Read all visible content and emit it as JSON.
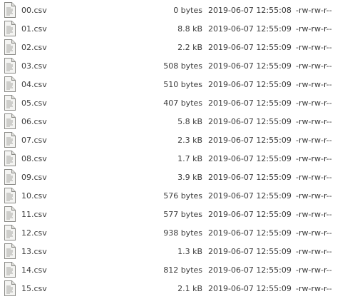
{
  "files": [
    {
      "name": "00.csv",
      "size": "0 bytes",
      "modified": "2019-06-07 12:55:08",
      "permissions": "-rw-rw-r--",
      "icon": "text-file-icon"
    },
    {
      "name": "01.csv",
      "size": "8.8 kB",
      "modified": "2019-06-07 12:55:09",
      "permissions": "-rw-rw-r--",
      "icon": "text-file-icon"
    },
    {
      "name": "02.csv",
      "size": "2.2 kB",
      "modified": "2019-06-07 12:55:09",
      "permissions": "-rw-rw-r--",
      "icon": "text-file-icon"
    },
    {
      "name": "03.csv",
      "size": "508 bytes",
      "modified": "2019-06-07 12:55:09",
      "permissions": "-rw-rw-r--",
      "icon": "text-file-icon"
    },
    {
      "name": "04.csv",
      "size": "510 bytes",
      "modified": "2019-06-07 12:55:09",
      "permissions": "-rw-rw-r--",
      "icon": "text-file-icon"
    },
    {
      "name": "05.csv",
      "size": "407 bytes",
      "modified": "2019-06-07 12:55:09",
      "permissions": "-rw-rw-r--",
      "icon": "text-file-icon"
    },
    {
      "name": "06.csv",
      "size": "5.8 kB",
      "modified": "2019-06-07 12:55:09",
      "permissions": "-rw-rw-r--",
      "icon": "text-file-icon"
    },
    {
      "name": "07.csv",
      "size": "2.3 kB",
      "modified": "2019-06-07 12:55:09",
      "permissions": "-rw-rw-r--",
      "icon": "text-file-icon"
    },
    {
      "name": "08.csv",
      "size": "1.7 kB",
      "modified": "2019-06-07 12:55:09",
      "permissions": "-rw-rw-r--",
      "icon": "text-file-icon"
    },
    {
      "name": "09.csv",
      "size": "3.9 kB",
      "modified": "2019-06-07 12:55:09",
      "permissions": "-rw-rw-r--",
      "icon": "text-file-icon"
    },
    {
      "name": "10.csv",
      "size": "576 bytes",
      "modified": "2019-06-07 12:55:09",
      "permissions": "-rw-rw-r--",
      "icon": "text-file-icon"
    },
    {
      "name": "11.csv",
      "size": "577 bytes",
      "modified": "2019-06-07 12:55:09",
      "permissions": "-rw-rw-r--",
      "icon": "text-file-icon"
    },
    {
      "name": "12.csv",
      "size": "938 bytes",
      "modified": "2019-06-07 12:55:09",
      "permissions": "-rw-rw-r--",
      "icon": "text-file-icon"
    },
    {
      "name": "13.csv",
      "size": "1.3 kB",
      "modified": "2019-06-07 12:55:09",
      "permissions": "-rw-rw-r--",
      "icon": "text-file-icon"
    },
    {
      "name": "14.csv",
      "size": "812 bytes",
      "modified": "2019-06-07 12:55:09",
      "permissions": "-rw-rw-r--",
      "icon": "text-file-icon"
    },
    {
      "name": "15.csv",
      "size": "2.1 kB",
      "modified": "2019-06-07 12:55:09",
      "permissions": "-rw-rw-r--",
      "icon": "text-file-icon"
    }
  ]
}
